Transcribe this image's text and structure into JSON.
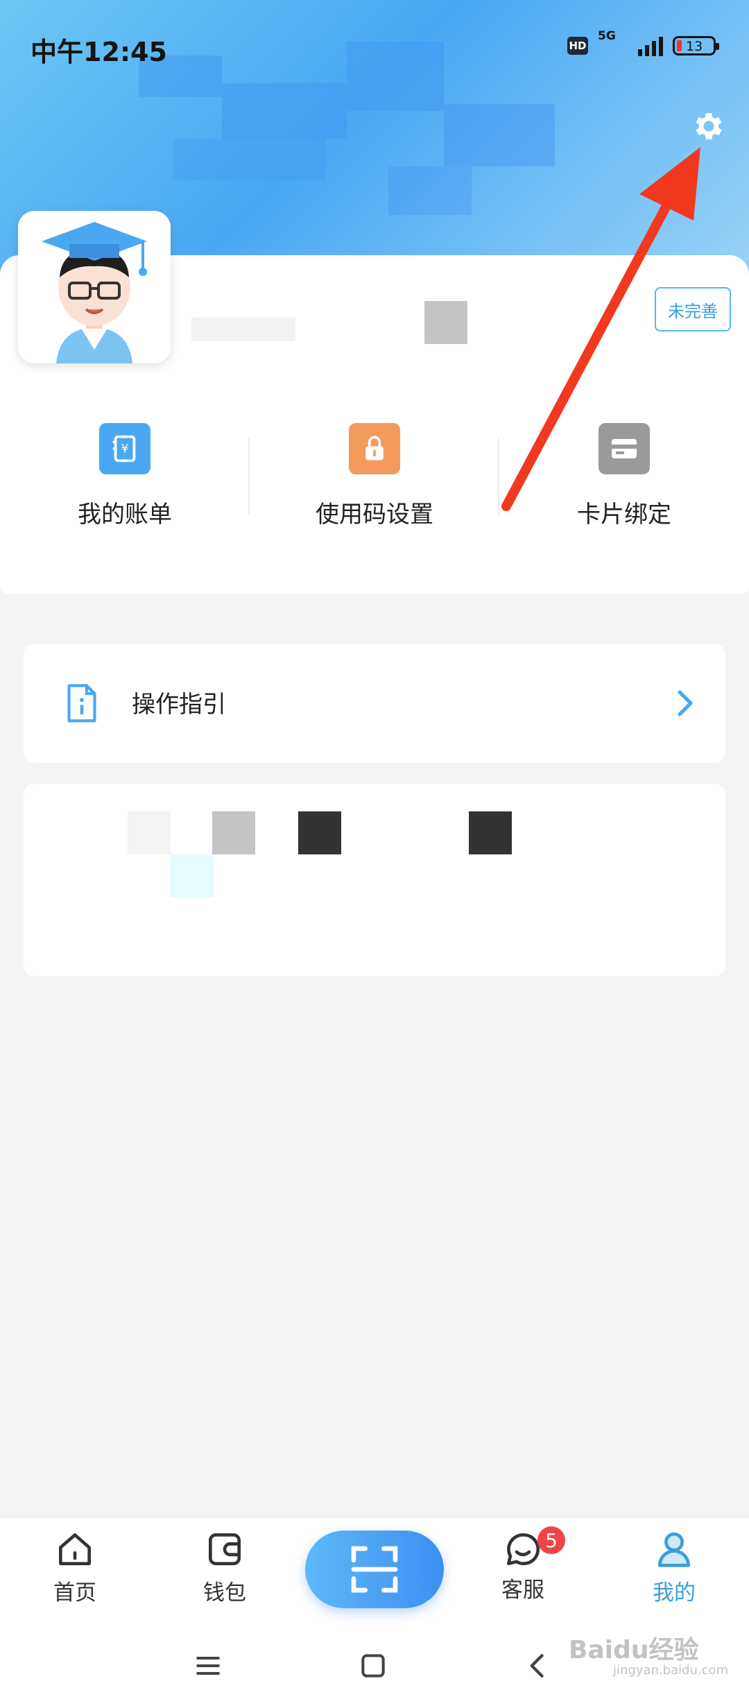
{
  "status_bar": {
    "time": "中午12:45",
    "hd": "HD",
    "network": "5G",
    "battery": "13"
  },
  "profile": {
    "incomplete_tag": "未完善"
  },
  "shortcuts": [
    {
      "label": "我的账单",
      "icon": "bill-icon",
      "color": "#4aa8f2"
    },
    {
      "label": "使用码设置",
      "icon": "lock-icon",
      "color": "#f49a5c"
    },
    {
      "label": "卡片绑定",
      "icon": "card-icon",
      "color": "#9a9a9a"
    }
  ],
  "guide": {
    "label": "操作指引"
  },
  "bottom_nav": {
    "items": [
      {
        "label": "首页",
        "icon": "home-icon"
      },
      {
        "label": "钱包",
        "icon": "wallet-icon"
      },
      {
        "label": "客服",
        "icon": "chat-icon",
        "badge": "5"
      },
      {
        "label": "我的",
        "icon": "user-icon",
        "active": true
      }
    ]
  },
  "watermark": {
    "text": "Baidu经验",
    "sub": "jingyan.baidu.com"
  },
  "colors": {
    "accent": "#3a9ed8",
    "arrow": "#f0391f",
    "scan_gradient_start": "#5fb8f7",
    "scan_gradient_end": "#3d8ff2"
  }
}
